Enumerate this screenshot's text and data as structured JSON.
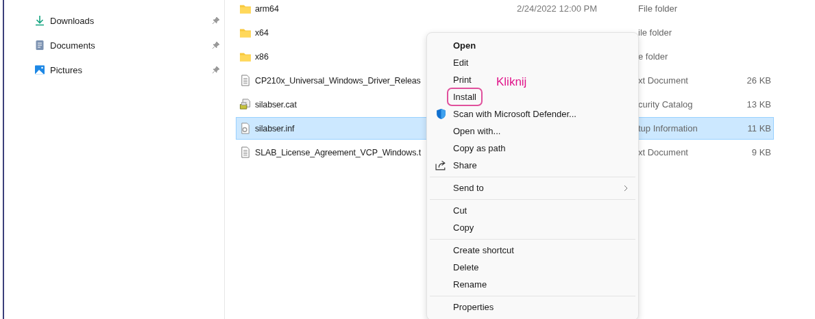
{
  "sidebar": {
    "items": [
      {
        "label": "Downloads",
        "kind": "download",
        "pinned": true
      },
      {
        "label": "Documents",
        "kind": "document",
        "pinned": true
      },
      {
        "label": "Pictures",
        "kind": "pictures",
        "pinned": true
      }
    ]
  },
  "files": [
    {
      "name": "arm64",
      "kind": "folder",
      "date": "2/24/2022 12:00 PM",
      "type": "File folder",
      "selected": false
    },
    {
      "name": "x64",
      "kind": "folder",
      "type": "ile folder",
      "selected": false
    },
    {
      "name": "x86",
      "kind": "folder",
      "type": "e folder",
      "selected": false
    },
    {
      "name": "CP210x_Universal_Windows_Driver_Releas",
      "kind": "text",
      "type": "xt Document",
      "size": "26 KB",
      "selected": false
    },
    {
      "name": "silabser.cat",
      "kind": "catalog",
      "type": "curity Catalog",
      "size": "13 KB",
      "selected": false
    },
    {
      "name": "silabser.inf",
      "kind": "setup",
      "type": "tup Information",
      "size": "11 KB",
      "selected": true
    },
    {
      "name": "SLAB_License_Agreement_VCP_Windows.t",
      "kind": "text",
      "type": "xt Document",
      "size": "9 KB",
      "selected": false
    }
  ],
  "context_menu": {
    "groups": [
      [
        {
          "label": "Open",
          "bold": true,
          "highlighted": false
        },
        {
          "label": "Edit",
          "bold": false,
          "highlighted": false
        },
        {
          "label": "Print",
          "bold": false,
          "highlighted": false
        },
        {
          "label": "Install",
          "bold": false,
          "highlighted": true
        },
        {
          "label": "Scan with Microsoft Defender...",
          "kind": "shield",
          "bold": false,
          "highlighted": false
        },
        {
          "label": "Open with...",
          "bold": false,
          "highlighted": false
        },
        {
          "label": "Copy as path",
          "bold": false,
          "highlighted": false
        },
        {
          "label": "Share",
          "kind": "share",
          "bold": false,
          "highlighted": false
        }
      ],
      [
        {
          "label": "Send to",
          "submenu": true,
          "bold": false,
          "highlighted": false
        }
      ],
      [
        {
          "label": "Cut",
          "bold": false,
          "highlighted": false
        },
        {
          "label": "Copy",
          "bold": false,
          "highlighted": false
        }
      ],
      [
        {
          "label": "Create shortcut",
          "bold": false,
          "highlighted": false
        },
        {
          "label": "Delete",
          "bold": false,
          "highlighted": false
        },
        {
          "label": "Rename",
          "bold": false,
          "highlighted": false
        }
      ],
      [
        {
          "label": "Properties",
          "bold": false,
          "highlighted": false
        }
      ]
    ]
  },
  "annotation": {
    "text": "Kliknij"
  }
}
